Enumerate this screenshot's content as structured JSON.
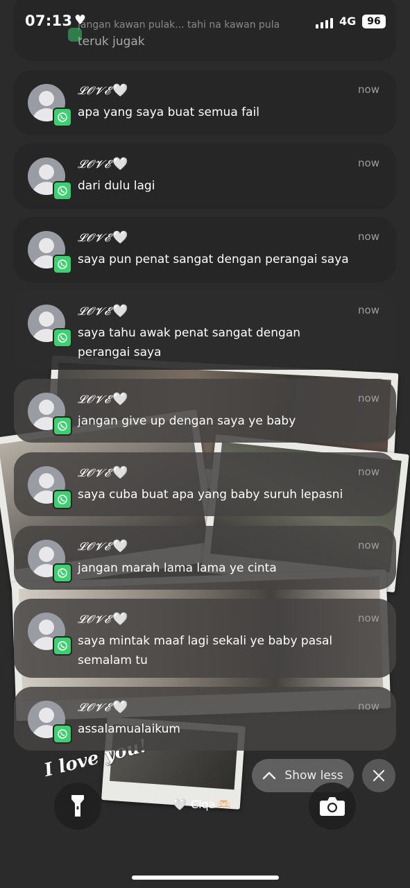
{
  "status_bar": {
    "time": "07:13",
    "heart": "♥",
    "network": "4G",
    "battery": "96"
  },
  "top_notification": {
    "faded_text": "jangan kawan pulak... tahi na kawan pula",
    "text": "teruk jugak"
  },
  "notifications": [
    {
      "sender": "𝓛𝓞𝓥𝓔",
      "heart": "🤍",
      "time": "now",
      "message": "apa yang saya buat semua fail"
    },
    {
      "sender": "𝓛𝓞𝓥𝓔",
      "heart": "🤍",
      "time": "now",
      "message": "dari dulu lagi"
    },
    {
      "sender": "𝓛𝓞𝓥𝓔",
      "heart": "🤍",
      "time": "now",
      "message": "saya pun penat sangat dengan perangai saya"
    },
    {
      "sender": "𝓛𝓞𝓥𝓔",
      "heart": "🤍",
      "time": "now",
      "message": "saya tahu awak penat sangat dengan perangai saya"
    },
    {
      "sender": "𝓛𝓞𝓥𝓔",
      "heart": "🤍",
      "time": "now",
      "message": "jangan give up dengan saya ye baby"
    },
    {
      "sender": "𝓛𝓞𝓥𝓔",
      "heart": "🤍",
      "time": "now",
      "message": "saya cuba buat apa yang baby suruh lepasni"
    },
    {
      "sender": "𝓛𝓞𝓥𝓔",
      "heart": "🤍",
      "time": "now",
      "message": "jangan marah lama lama ye cinta"
    },
    {
      "sender": "𝓛𝓞𝓥𝓔",
      "heart": "🤍",
      "time": "now",
      "message": "saya mintak maaf lagi sekali ye baby pasal semalam tu"
    },
    {
      "sender": "𝓛𝓞𝓥𝓔",
      "heart": "🤍",
      "time": "now",
      "message": "assalamualaikum"
    }
  ],
  "controls": {
    "show_less": "Show less",
    "owner_name": "Ciqa",
    "owner_heart": "🤍",
    "owner_emoji": "🫶🏻"
  },
  "wallpaper": {
    "script_text": "I love you!"
  },
  "colors": {
    "whatsapp_green": "#3bd16f",
    "card_bg": "#262626",
    "muted_text": "#9d9d9d"
  }
}
